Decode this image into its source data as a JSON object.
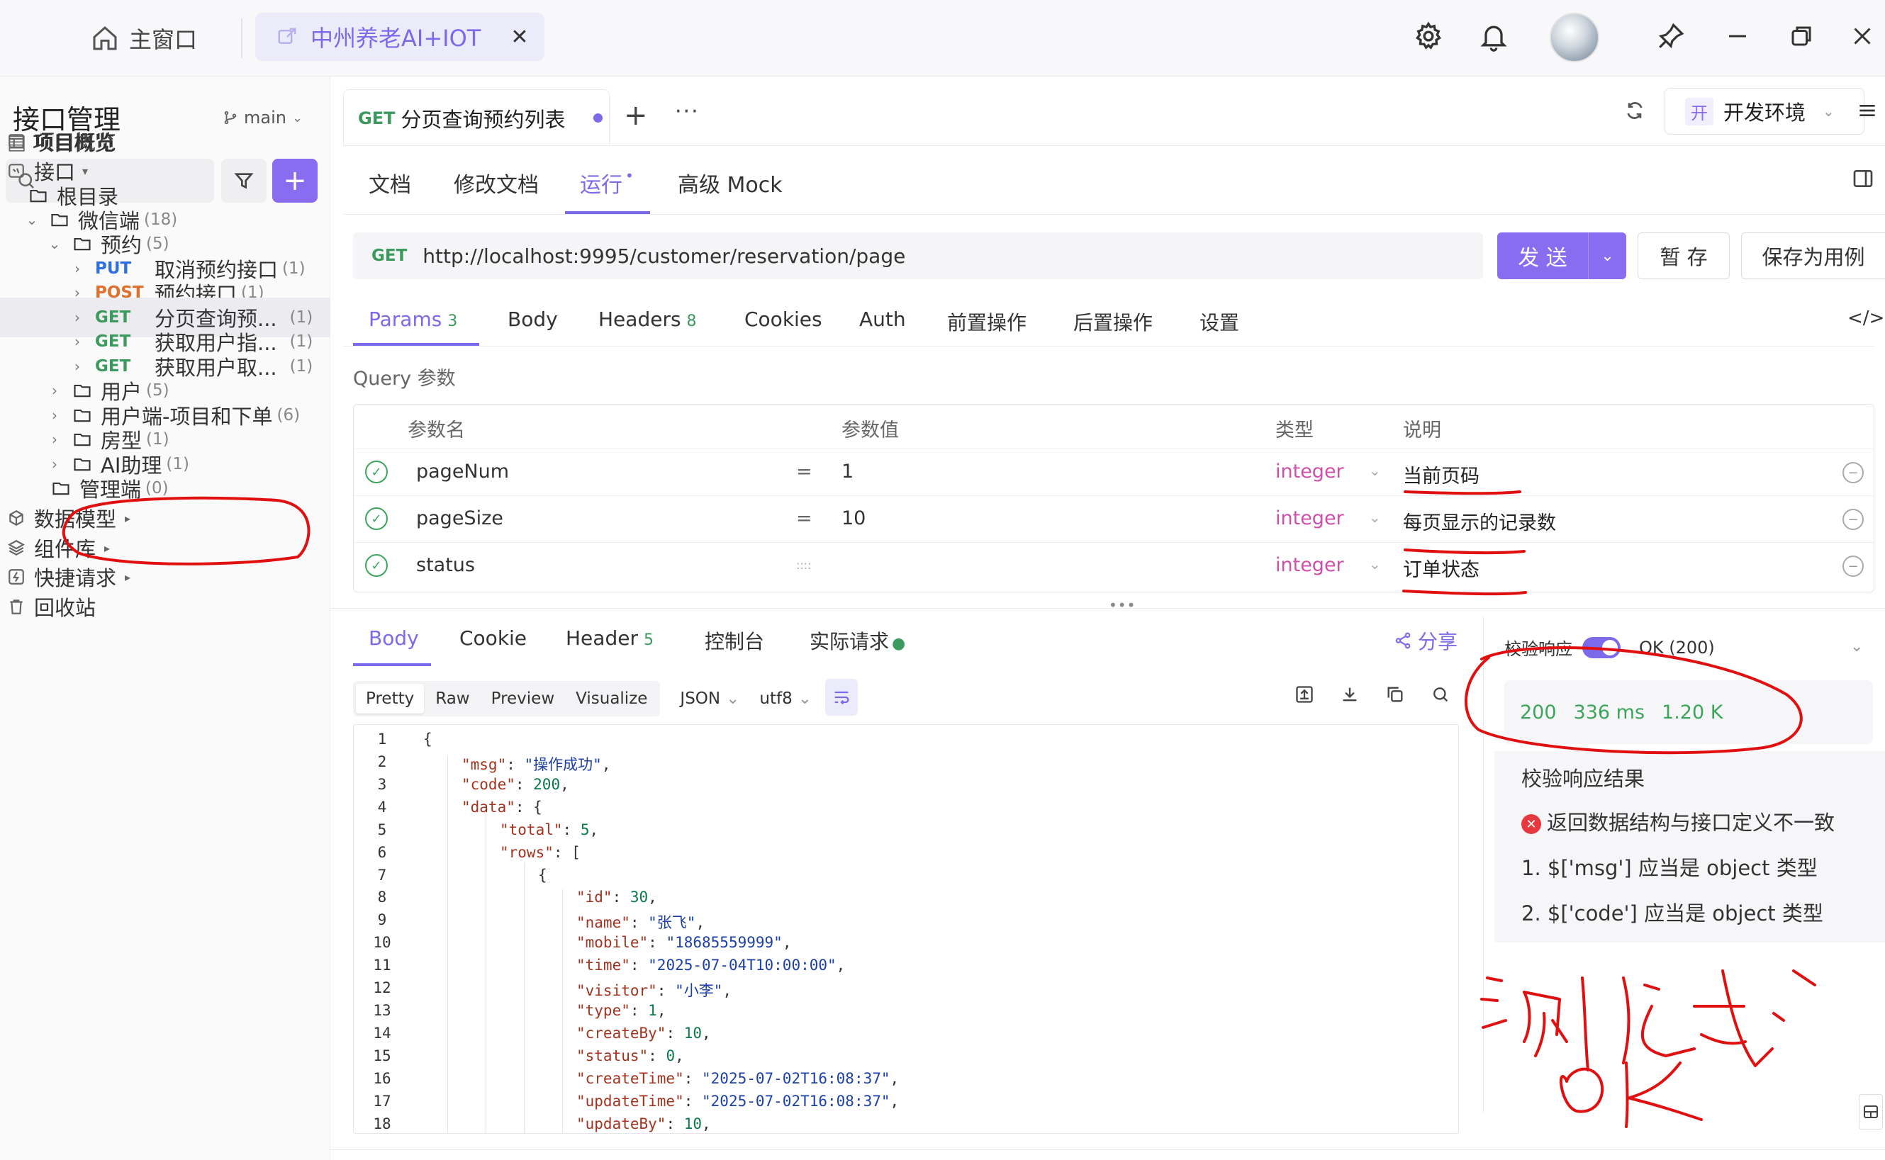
{
  "titlebar": {
    "home_label": "主窗口",
    "project_tab": "中州养老AI+IOT",
    "close_glyph": "✕"
  },
  "sidebar": {
    "title": "接口管理",
    "branch": "main",
    "add_glyph": "+",
    "tree": [
      {
        "label": "项目概览",
        "icon": "overview-icon"
      },
      {
        "label": "接口",
        "icon": "api-icon"
      },
      {
        "label": "根目录",
        "icon": "folder-icon"
      },
      {
        "label": "微信端",
        "count": "(18)"
      },
      {
        "label": "预约",
        "count": "(5)"
      },
      {
        "method": "PUT",
        "label": "取消预约接口",
        "count": "(1)"
      },
      {
        "method": "POST",
        "label": "预约接口",
        "count": "(1)"
      },
      {
        "method": "GET",
        "label": "分页查询预...",
        "count": "(1)"
      },
      {
        "method": "GET",
        "label": "获取用户指...",
        "count": "(1)"
      },
      {
        "method": "GET",
        "label": "获取用户取...",
        "count": "(1)"
      },
      {
        "label": "用户",
        "count": "(5)"
      },
      {
        "label": "用户端-项目和下单",
        "count": "(6)"
      },
      {
        "label": "房型",
        "count": "(1)"
      },
      {
        "label": "AI助理",
        "count": "(1)"
      },
      {
        "label": "管理端",
        "count": "(0)"
      },
      {
        "label": "数据模型",
        "icon": "data-model-icon"
      },
      {
        "label": "组件库",
        "icon": "component-library-icon"
      },
      {
        "label": "快捷请求",
        "icon": "quick-request-icon"
      },
      {
        "label": "回收站",
        "icon": "trash-icon"
      }
    ]
  },
  "doc_tab": {
    "method": "GET",
    "title": "分页查询预约列表",
    "more": "···",
    "add": "+"
  },
  "env": {
    "badge": "开",
    "label": "开发环境"
  },
  "subtabs": [
    "文档",
    "修改文档",
    "运行",
    "高级 Mock"
  ],
  "request": {
    "method": "GET",
    "url": "http://localhost:9995/customer/reservation/page",
    "send": "发 送",
    "save": "暂 存",
    "save_case": "保存为用例"
  },
  "param_tabs": [
    {
      "label": "Params",
      "count": "3"
    },
    {
      "label": "Body"
    },
    {
      "label": "Headers",
      "count": "8"
    },
    {
      "label": "Cookies"
    },
    {
      "label": "Auth"
    },
    {
      "label": "前置操作"
    },
    {
      "label": "后置操作"
    },
    {
      "label": "设置"
    }
  ],
  "query": {
    "label": "Query 参数",
    "headers": [
      "参数名",
      "参数值",
      "类型",
      "说明"
    ],
    "rows": [
      {
        "name": "pageNum",
        "op": "=",
        "value": "1",
        "type": "integer",
        "desc": "当前页码"
      },
      {
        "name": "pageSize",
        "op": "=",
        "value": "10",
        "type": "integer",
        "desc": "每页显示的记录数"
      },
      {
        "name": "status",
        "op": "::::",
        "value": "",
        "type": "integer",
        "desc": "订单状态"
      }
    ]
  },
  "response_tabs": [
    {
      "label": "Body"
    },
    {
      "label": "Cookie"
    },
    {
      "label": "Header",
      "count": "5"
    },
    {
      "label": "控制台"
    },
    {
      "label": "实际请求"
    }
  ],
  "share": "分享",
  "format": {
    "modes": [
      "Pretty",
      "Raw",
      "Preview",
      "Visualize"
    ],
    "lang": "JSON",
    "encoding": "utf8"
  },
  "code_lines": [
    {
      "n": "1",
      "indent": 0,
      "text": "{"
    },
    {
      "n": "2",
      "indent": 1,
      "key": "\"msg\"",
      "val": "\"操作成功\"",
      "vt": "s",
      "tail": ","
    },
    {
      "n": "3",
      "indent": 1,
      "key": "\"code\"",
      "val": "200",
      "vt": "nb",
      "tail": ","
    },
    {
      "n": "4",
      "indent": 1,
      "key": "\"data\"",
      "val": "{",
      "vt": "p",
      "tail": ""
    },
    {
      "n": "5",
      "indent": 2,
      "key": "\"total\"",
      "val": "5",
      "vt": "nb",
      "tail": ","
    },
    {
      "n": "6",
      "indent": 2,
      "key": "\"rows\"",
      "val": "[",
      "vt": "p",
      "tail": ""
    },
    {
      "n": "7",
      "indent": 3,
      "text": "{"
    },
    {
      "n": "8",
      "indent": 4,
      "key": "\"id\"",
      "val": "30",
      "vt": "nb",
      "tail": ","
    },
    {
      "n": "9",
      "indent": 4,
      "key": "\"name\"",
      "val": "\"张飞\"",
      "vt": "s",
      "tail": ","
    },
    {
      "n": "10",
      "indent": 4,
      "key": "\"mobile\"",
      "val": "\"18685559999\"",
      "vt": "s",
      "tail": ","
    },
    {
      "n": "11",
      "indent": 4,
      "key": "\"time\"",
      "val": "\"2025-07-04T10:00:00\"",
      "vt": "s",
      "tail": ","
    },
    {
      "n": "12",
      "indent": 4,
      "key": "\"visitor\"",
      "val": "\"小李\"",
      "vt": "s",
      "tail": ","
    },
    {
      "n": "13",
      "indent": 4,
      "key": "\"type\"",
      "val": "1",
      "vt": "nb",
      "tail": ","
    },
    {
      "n": "14",
      "indent": 4,
      "key": "\"createBy\"",
      "val": "10",
      "vt": "nb",
      "tail": ","
    },
    {
      "n": "15",
      "indent": 4,
      "key": "\"status\"",
      "val": "0",
      "vt": "nb",
      "tail": ","
    },
    {
      "n": "16",
      "indent": 4,
      "key": "\"createTime\"",
      "val": "\"2025-07-02T16:08:37\"",
      "vt": "s",
      "tail": ","
    },
    {
      "n": "17",
      "indent": 4,
      "key": "\"updateTime\"",
      "val": "\"2025-07-02T16:08:37\"",
      "vt": "s",
      "tail": ","
    },
    {
      "n": "18",
      "indent": 4,
      "key": "\"updateBy\"",
      "val": "10",
      "vt": "nb",
      "tail": ","
    }
  ],
  "verify": {
    "label": "校验响应",
    "status": "OK (200)",
    "code": "200",
    "time": "336 ms",
    "size": "1.20 K",
    "result_title": "校验响应结果",
    "error": "返回数据结构与接口定义不一致",
    "items": [
      "1. $['msg'] 应当是 object 类型",
      "2. $['code'] 应当是 object 类型"
    ]
  },
  "annotation": {
    "handwriting": "测试 OK"
  },
  "colors": {
    "accent": "#7b6bea",
    "get": "#3c9a5f",
    "post": "#e0702f",
    "put": "#2f6fe0",
    "type": "#d04fa8",
    "annotation": "#e01010"
  }
}
